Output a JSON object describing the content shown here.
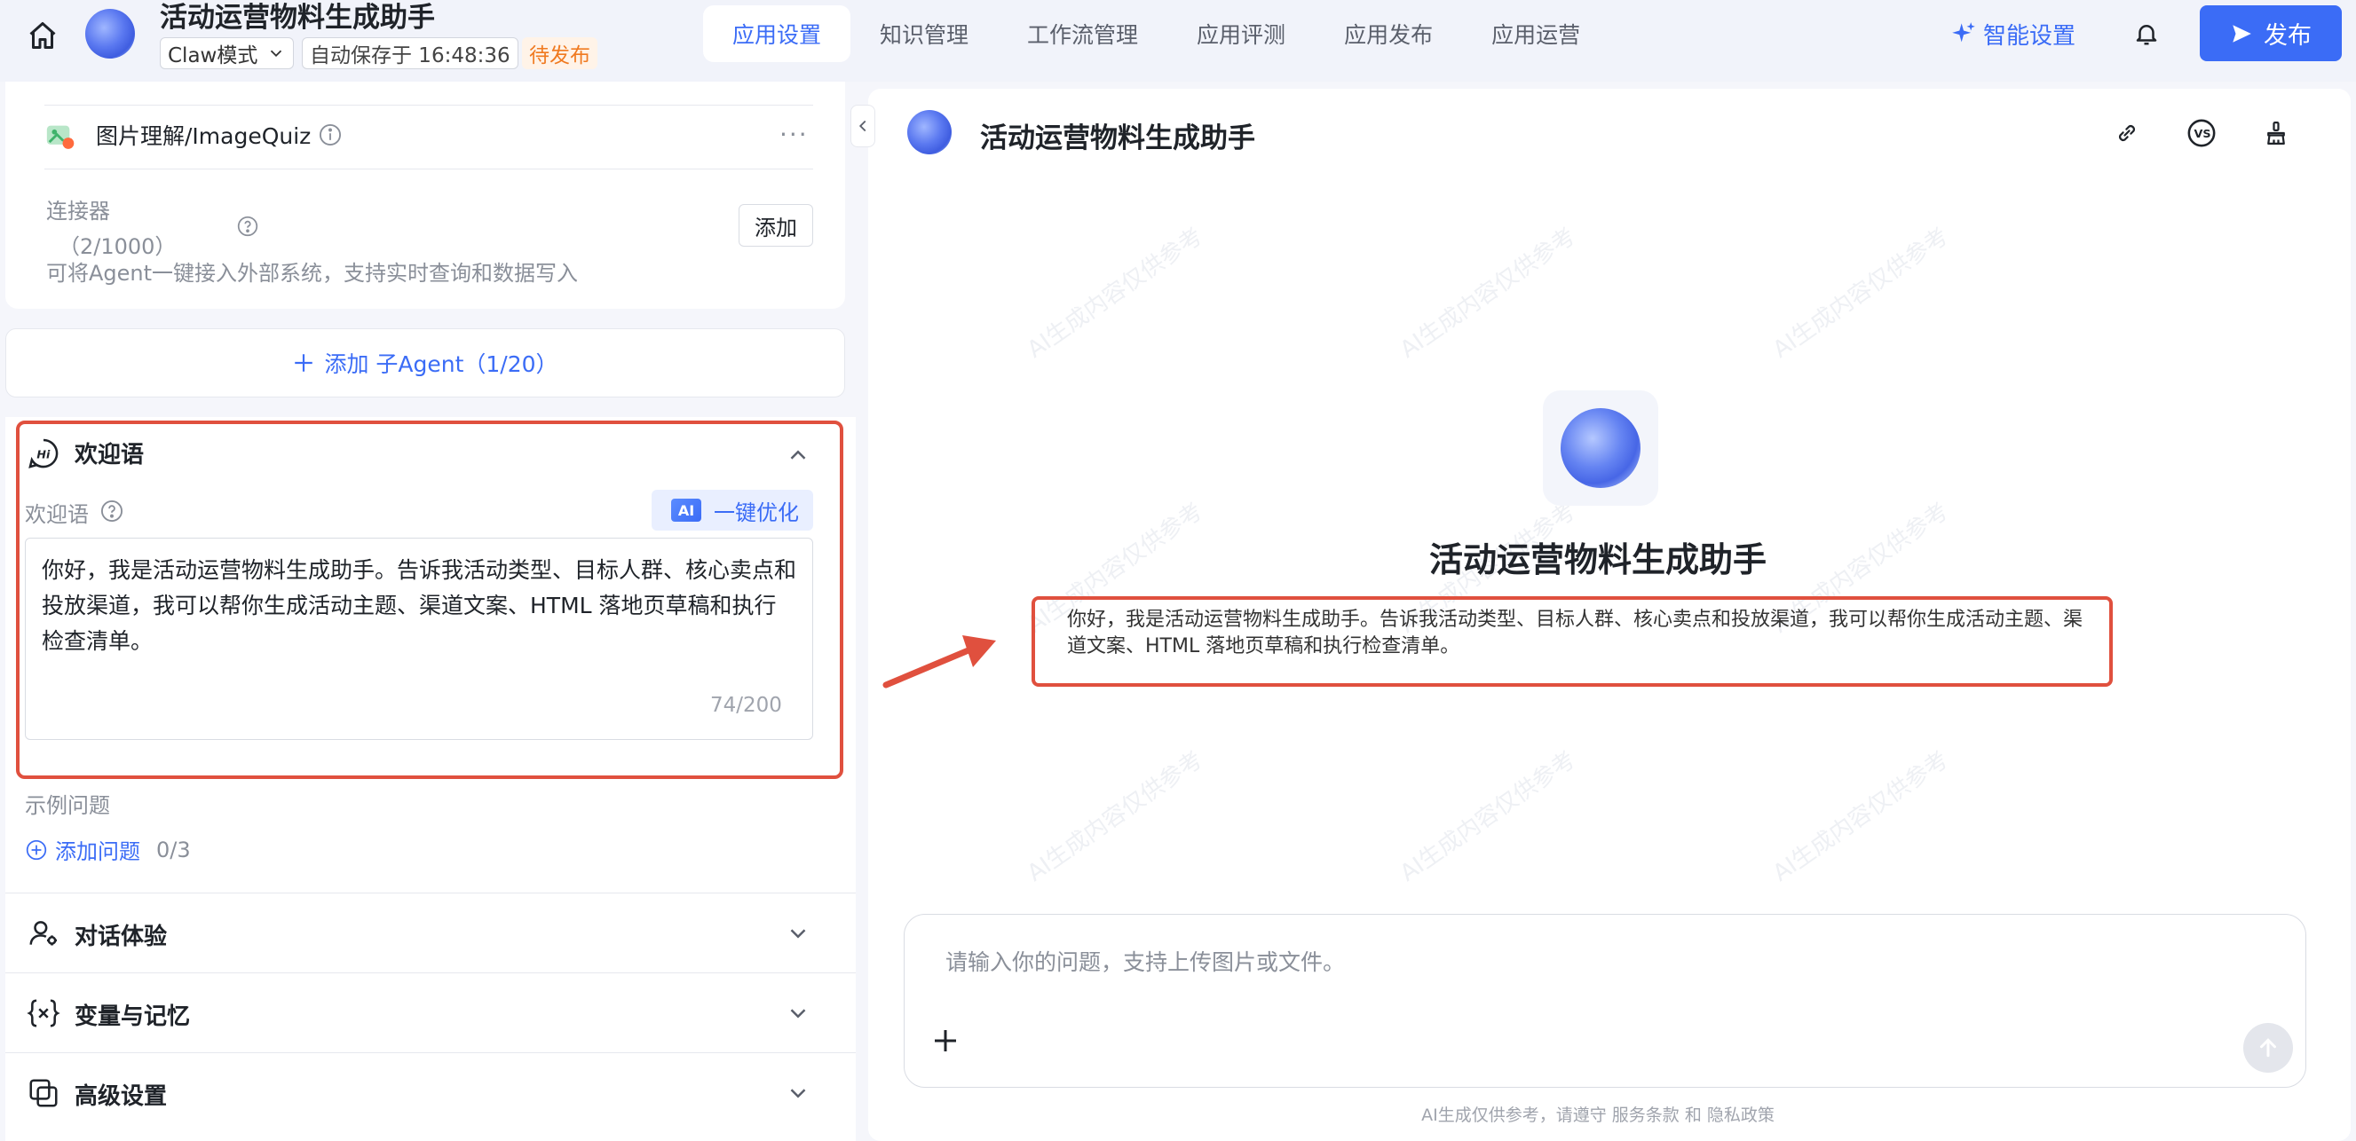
{
  "header": {
    "app_title": "活动运营物料生成助手",
    "mode": "Claw模式",
    "autosave": "自动保存于 16:48:36",
    "status": "待发布",
    "tabs": [
      "应用设置",
      "知识管理",
      "工作流管理",
      "应用评测",
      "应用发布",
      "应用运营"
    ],
    "active_tab": "应用设置",
    "smart_settings": "智能设置",
    "publish": "发布"
  },
  "left": {
    "plugin": {
      "name": "图片理解/ImageQuiz",
      "more": "···"
    },
    "connector": {
      "title": "连接器",
      "count": "（2/1000）",
      "add": "添加",
      "desc": "可将Agent一键接入外部系统，支持实时查询和数据写入"
    },
    "add_agent": "添加 子Agent（1/20）",
    "welcome": {
      "section_title": "欢迎语",
      "label": "欢迎语",
      "ai_badge": "AI",
      "optimize": "一键优化",
      "text": "你好，我是活动运营物料生成助手。告诉我活动类型、目标人群、核心卖点和投放渠道，我可以帮你生成活动主题、渠道文案、HTML 落地页草稿和执行检查清单。",
      "count": "74/200"
    },
    "examples": {
      "label": "示例问题",
      "add": "添加问题",
      "count": "0/3"
    },
    "accordions": {
      "dialog": "对话体验",
      "vars": "变量与记忆",
      "advanced": "高级设置"
    }
  },
  "right": {
    "title": "活动运营物料生成助手",
    "hero_title": "活动运营物料生成助手",
    "welcome_text": "你好，我是活动运营物料生成助手。告诉我活动类型、目标人群、核心卖点和投放渠道，我可以帮你生成活动主题、渠道文案、HTML 落地页草稿和执行检查清单。",
    "input_placeholder": "请输入你的问题，支持上传图片或文件。",
    "disclaimer_prefix": "AI生成仅供参考，请遵守 ",
    "terms": "服务条款",
    "and": " 和 ",
    "privacy": "隐私政策",
    "watermark": "AI生成内容仅供参考"
  },
  "colors": {
    "accent": "#3b6cf6",
    "highlight": "#e0503e",
    "status": "#f07a20"
  },
  "icons": [
    "home-icon",
    "chevron-down-icon",
    "sparkle-icon",
    "bell-icon",
    "send-icon",
    "image-icon",
    "info-icon",
    "help-icon",
    "plus-icon",
    "hi-icon",
    "chevron-up-icon",
    "user-settings-icon",
    "variable-icon",
    "copy-settings-icon",
    "chevron-left-icon",
    "link-icon",
    "vs-icon",
    "brush-icon",
    "arrow-up-icon"
  ]
}
